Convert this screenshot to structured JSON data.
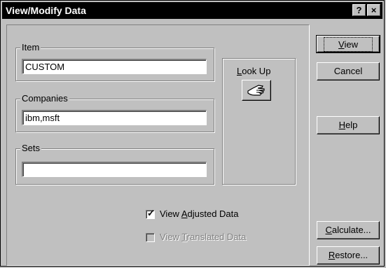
{
  "window": {
    "title": "View/Modify Data",
    "help_glyph": "?",
    "close_glyph": "×"
  },
  "item": {
    "legend": "Item",
    "value": "CUSTOM"
  },
  "companies": {
    "legend": "Companies",
    "value": "ibm,msft"
  },
  "sets": {
    "legend": "Sets",
    "value": ""
  },
  "lookup": {
    "label_pre": "",
    "label_u": "L",
    "label_post": "ook Up",
    "icon": "pointing-hand-icon"
  },
  "options": {
    "adjusted": {
      "pre": "View ",
      "u": "A",
      "post": "djusted Data",
      "checked": true
    },
    "translated": {
      "pre": "View ",
      "u": "T",
      "post": "ranslated Data",
      "checked": false,
      "disabled": true
    }
  },
  "buttons": {
    "view": {
      "pre": "",
      "u": "V",
      "post": "iew"
    },
    "cancel": {
      "label": "Cancel"
    },
    "help": {
      "pre": "",
      "u": "H",
      "post": "elp"
    },
    "calculate": {
      "pre": "",
      "u": "C",
      "post": "alculate..."
    },
    "restore": {
      "pre": "",
      "u": "R",
      "post": "estore..."
    }
  }
}
